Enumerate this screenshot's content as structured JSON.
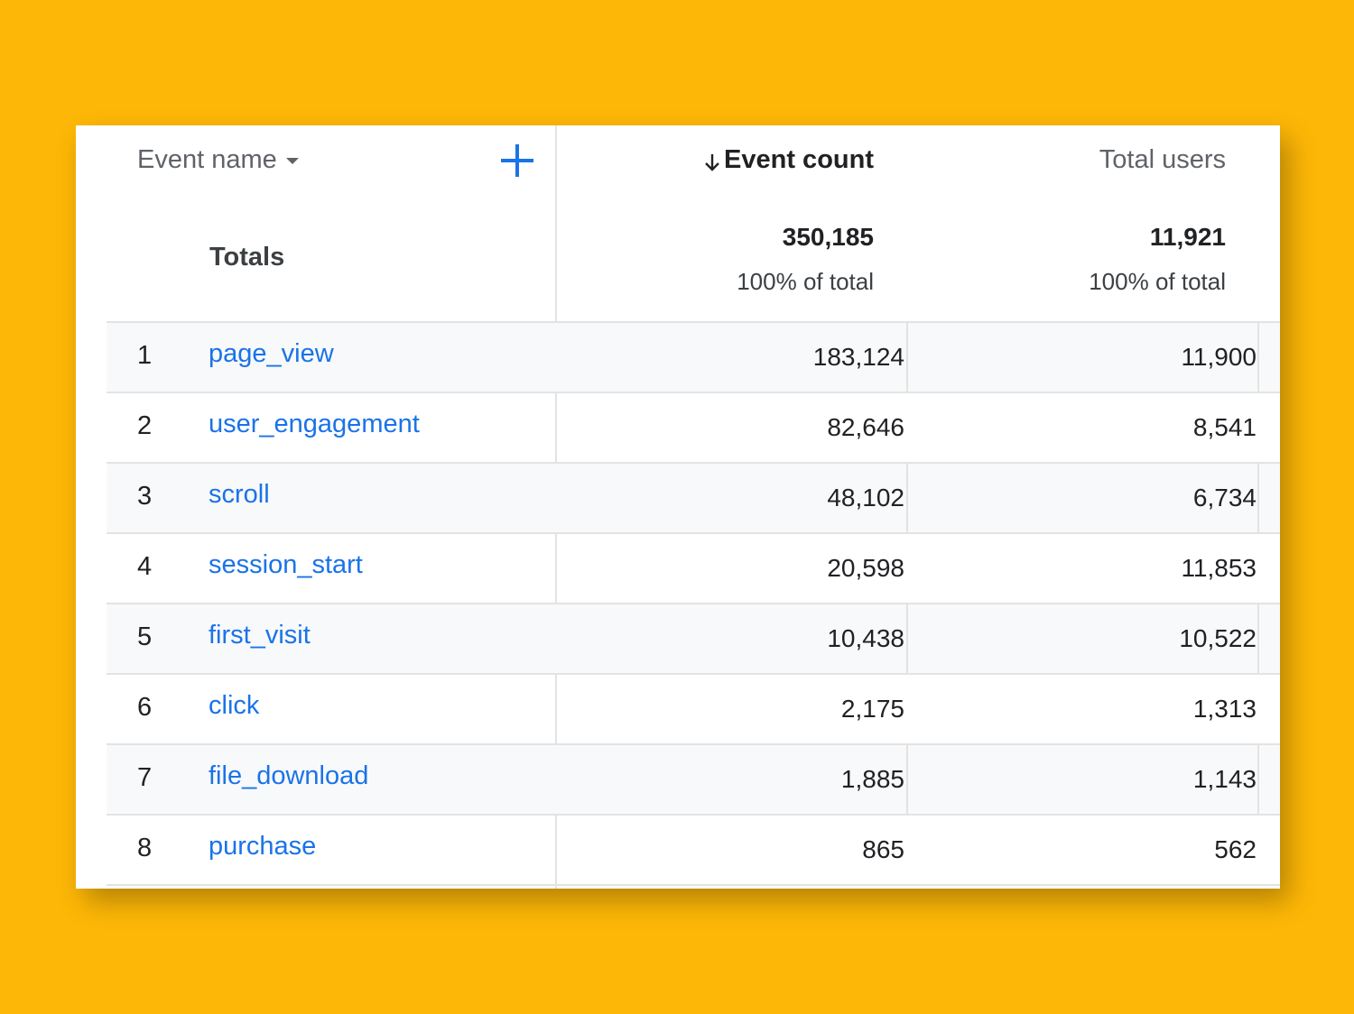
{
  "header": {
    "dimension_label": "Event name",
    "metric1_label": "Event count",
    "metric2_label": "Total users",
    "sort_arrow": "↓"
  },
  "totals": {
    "label": "Totals",
    "metric1_value": "350,185",
    "metric1_pct": "100% of total",
    "metric2_value": "11,921",
    "metric2_pct": "100% of total"
  },
  "rows": [
    {
      "rank": "1",
      "event": "page_view",
      "event_count": "183,124",
      "total_users": "11,900"
    },
    {
      "rank": "2",
      "event": "user_engagement",
      "event_count": "82,646",
      "total_users": "8,541"
    },
    {
      "rank": "3",
      "event": "scroll",
      "event_count": "48,102",
      "total_users": "6,734"
    },
    {
      "rank": "4",
      "event": "session_start",
      "event_count": "20,598",
      "total_users": "11,853"
    },
    {
      "rank": "5",
      "event": "first_visit",
      "event_count": "10,438",
      "total_users": "10,522"
    },
    {
      "rank": "6",
      "event": "click",
      "event_count": "2,175",
      "total_users": "1,313"
    },
    {
      "rank": "7",
      "event": "file_download",
      "event_count": "1,885",
      "total_users": "1,143"
    },
    {
      "rank": "8",
      "event": "purchase",
      "event_count": "865",
      "total_users": "562"
    }
  ],
  "colors": {
    "background": "#FDB706",
    "link": "#1a73e8",
    "accent": "#1a73e8"
  },
  "icons": {
    "dimension_dropdown": "caret-down-icon",
    "add_dimension": "plus-icon",
    "sort": "arrow-down-icon"
  }
}
